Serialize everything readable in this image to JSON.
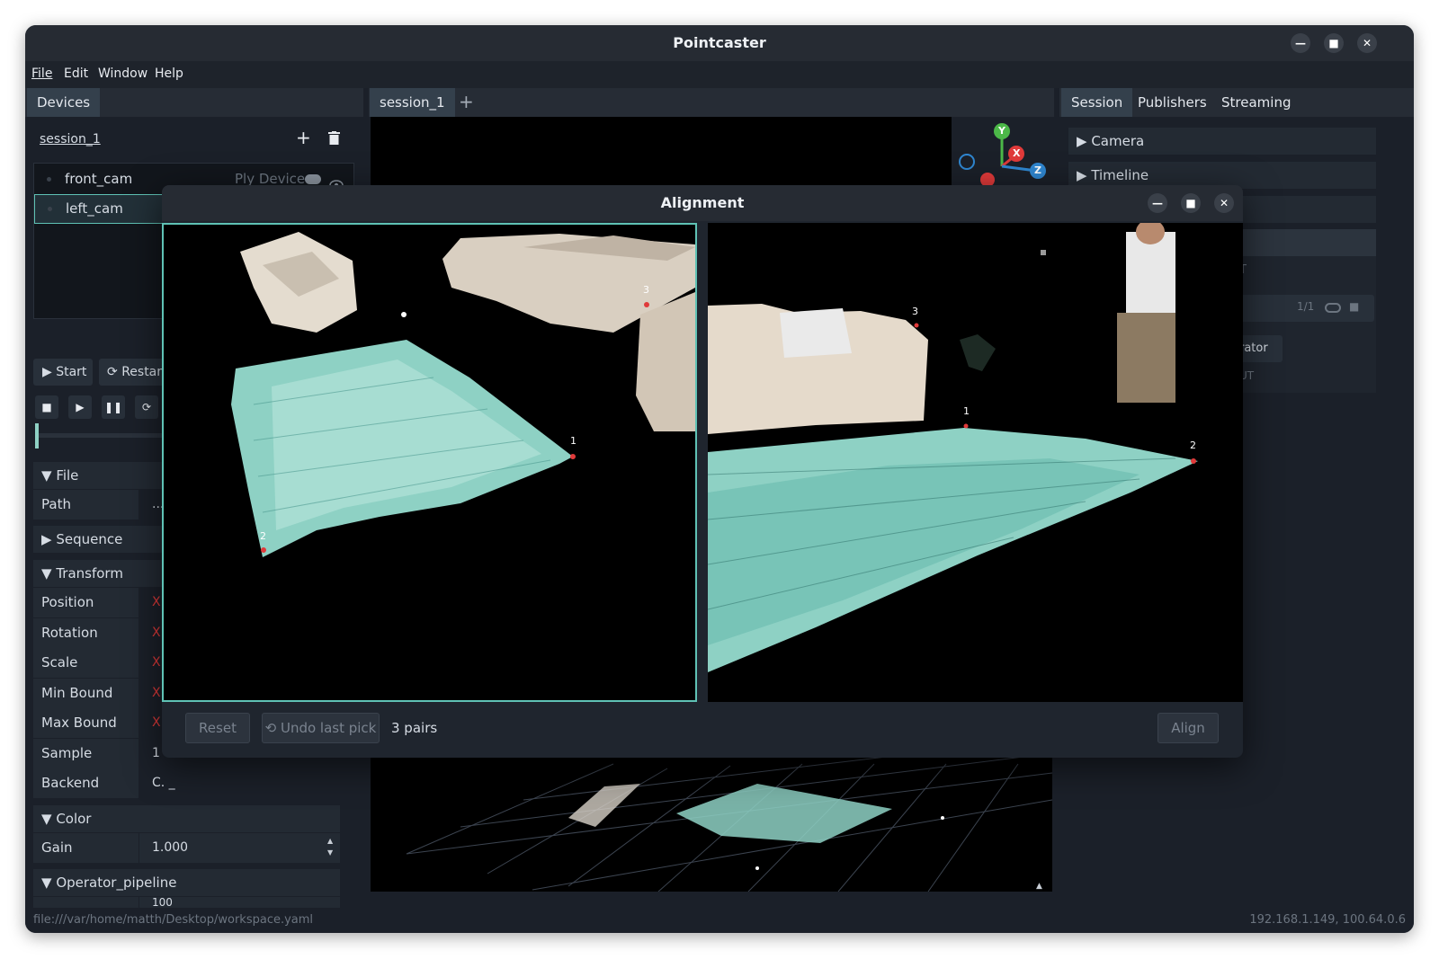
{
  "app": {
    "title": "Pointcaster",
    "menu": [
      "File",
      "Edit",
      "Window",
      "Help"
    ],
    "status_left": "file:///var/home/matth/Desktop/workspace.yaml",
    "status_right": "192.168.1.149, 100.64.0.6"
  },
  "left": {
    "tab": "Devices",
    "session": "session_1",
    "devices": [
      {
        "name": "front_cam",
        "type": "Ply Device"
      },
      {
        "name": "left_cam",
        "type": ""
      }
    ],
    "start": "Start",
    "restart": "Restart",
    "sections": {
      "file": "File",
      "sequence": "Sequence",
      "transform": "Transform",
      "color": "Color",
      "operator_pipeline": "Operator_pipeline"
    },
    "props": {
      "path": {
        "label": "Path",
        "value": "..."
      },
      "position": {
        "label": "Position",
        "value": "X"
      },
      "rotation": {
        "label": "Rotation",
        "value": "X"
      },
      "scale": {
        "label": "Scale",
        "value": "X"
      },
      "min_bound": {
        "label": "Min Bound",
        "value": "X"
      },
      "max_bound": {
        "label": "Max Bound",
        "value": "X"
      },
      "sample": {
        "label": "Sample",
        "value": "1"
      },
      "backend": {
        "label": "Backend",
        "value": "C. _"
      },
      "gain": {
        "label": "Gain",
        "value": "1.000"
      },
      "partial": {
        "label": "",
        "value": "100"
      }
    }
  },
  "center": {
    "tab": "session_1",
    "gizmo": {
      "y": "Y",
      "x": "X",
      "z": "Z"
    }
  },
  "right": {
    "tabs": [
      "Session",
      "Publishers",
      "Streaming"
    ],
    "sections": [
      "Camera",
      "Timeline"
    ],
    "counter": "1/1",
    "operator_partial": "rator",
    "label_partial": "T",
    "out_partial": "UT"
  },
  "dialog": {
    "title": "Alignment",
    "left_marks": [
      "1",
      "2",
      "3"
    ],
    "right_marks": [
      "1",
      "2",
      "3"
    ],
    "reset": "Reset",
    "undo": "Undo last pick",
    "pairs": "3 pairs",
    "align": "Align"
  },
  "colors": {
    "accent": "#5fc2b5",
    "background": "#1b2029",
    "cloud": "#8ed1c4",
    "marker": "#e03a3a"
  }
}
